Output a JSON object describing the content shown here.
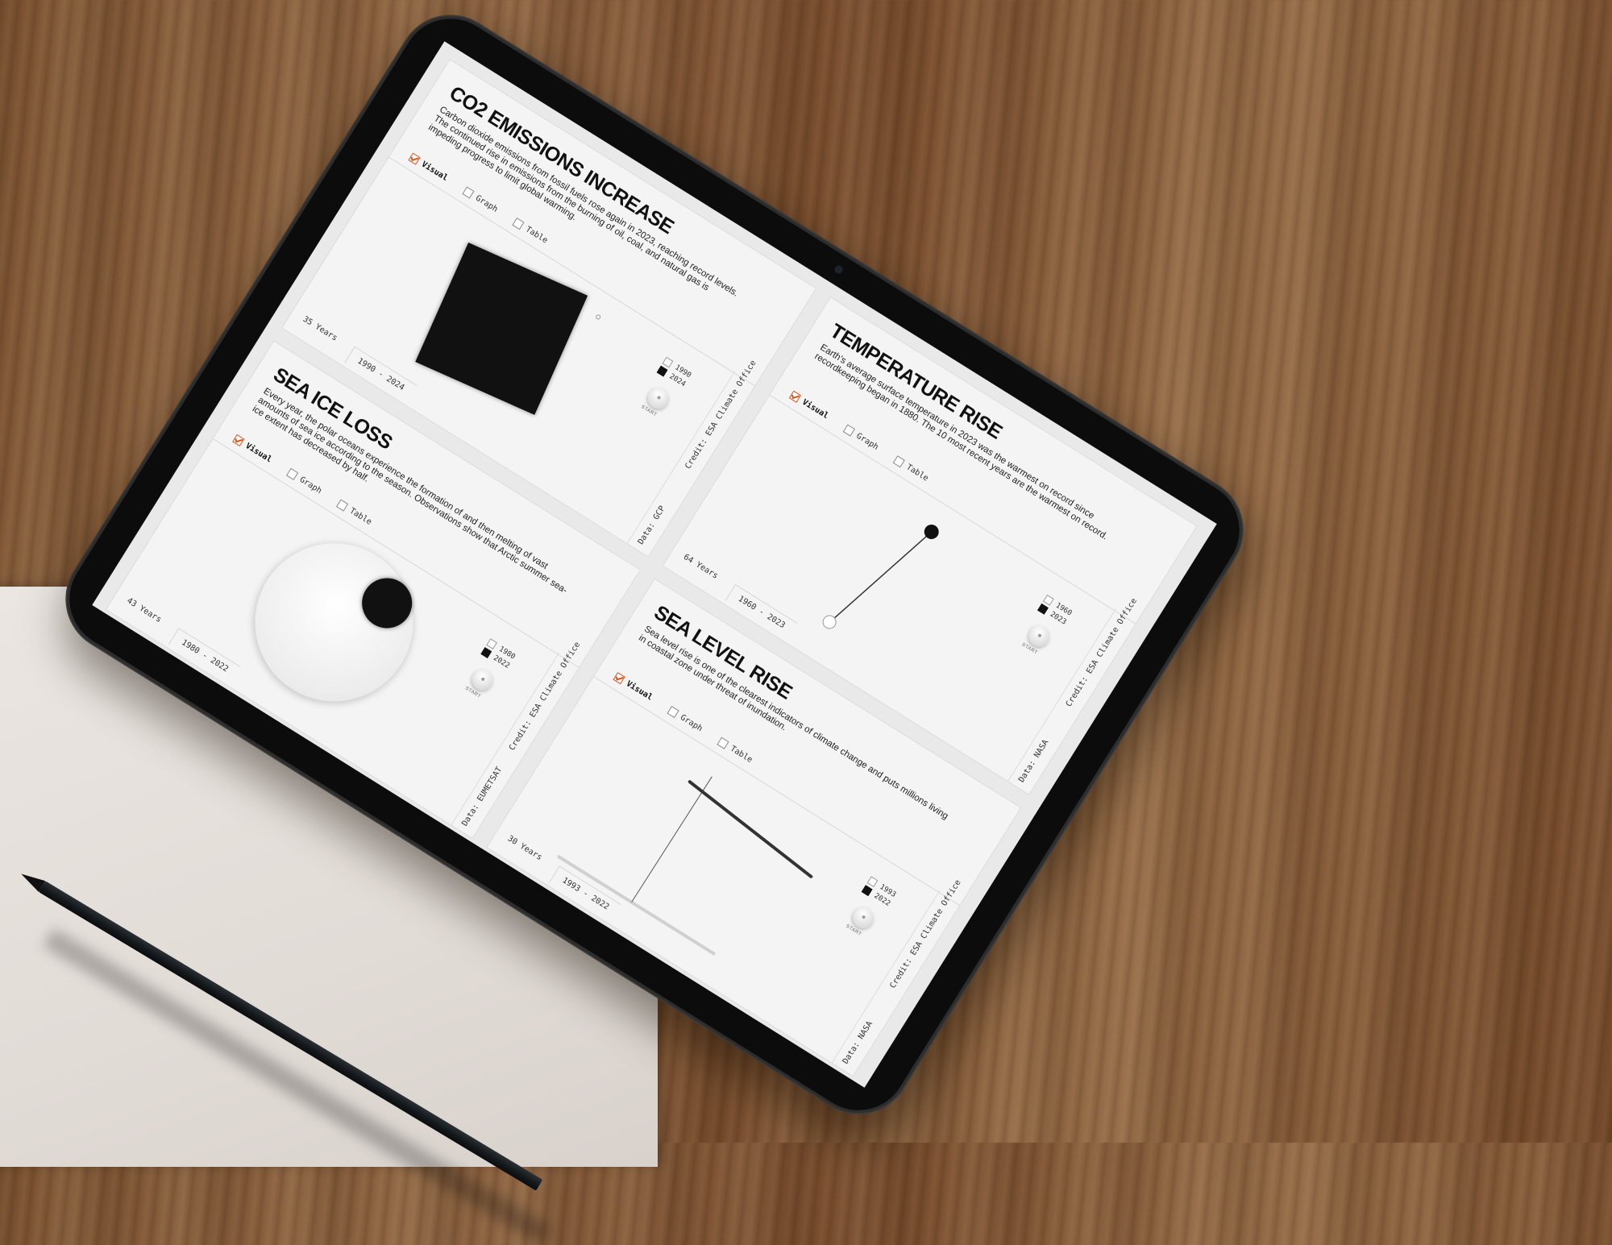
{
  "panels": {
    "co2": {
      "title": "CO2 EMISSIONS INCREASE",
      "description": "Carbon dioxide emissions from fossil fuels rose again in 2023, reaching record levels. The continued rise in emissions from the burning of oil, coal, and natural gas is impeding progress to limit global warming.",
      "tabs": [
        "Visual",
        "Graph",
        "Table"
      ],
      "legend": [
        "1990",
        "2024"
      ],
      "start_label": "START",
      "years": "35 Years",
      "range": "1990 - 2024",
      "credit": "Credit: ESA Climate Office",
      "data_source": "Data: GCP"
    },
    "temperature": {
      "title": "TEMPERATURE RISE",
      "description": "Earth's average surface temperature in 2023 was the warmest on record since recordkeeping began in 1880. The 10 most recent years are the warmest on record.",
      "tabs": [
        "Visual",
        "Graph",
        "Table"
      ],
      "legend": [
        "1960",
        "2023"
      ],
      "start_label": "START",
      "years": "64 Years",
      "range": "1960 - 2023",
      "credit": "Credit: ESA Climate Office",
      "data_source": "Data: NASA"
    },
    "sea_ice": {
      "title": "SEA ICE LOSS",
      "description": "Every year, the polar oceans experience the formation of and then melting of vast amounts of sea ice according to the season. Observations show that Arctic summer sea-ice extent has decreased by half.",
      "tabs": [
        "Visual",
        "Graph",
        "Table"
      ],
      "legend": [
        "1980",
        "2022"
      ],
      "start_label": "START",
      "years": "43 Years",
      "range": "1980 - 2022",
      "credit": "Credit: ESA Climate Office",
      "data_source": "Data: EUMETSAT"
    },
    "sea_level": {
      "title": "SEA LEVEL RISE",
      "description": "Sea level rise is one of the clearest indicators of climate change and puts millions living in coastal zone under threat of inundation.",
      "tabs": [
        "Visual",
        "Graph",
        "Table"
      ],
      "legend": [
        "1993",
        "2022"
      ],
      "start_label": "START",
      "years": "30 Years",
      "range": "1993 - 2022",
      "credit": "Credit: ESA Climate Office",
      "data_source": "Data: NASA"
    }
  },
  "colors": {
    "checkbox_accent": "#d9531e",
    "ink": "#111111",
    "panel_bg": "#f4f4f4"
  }
}
